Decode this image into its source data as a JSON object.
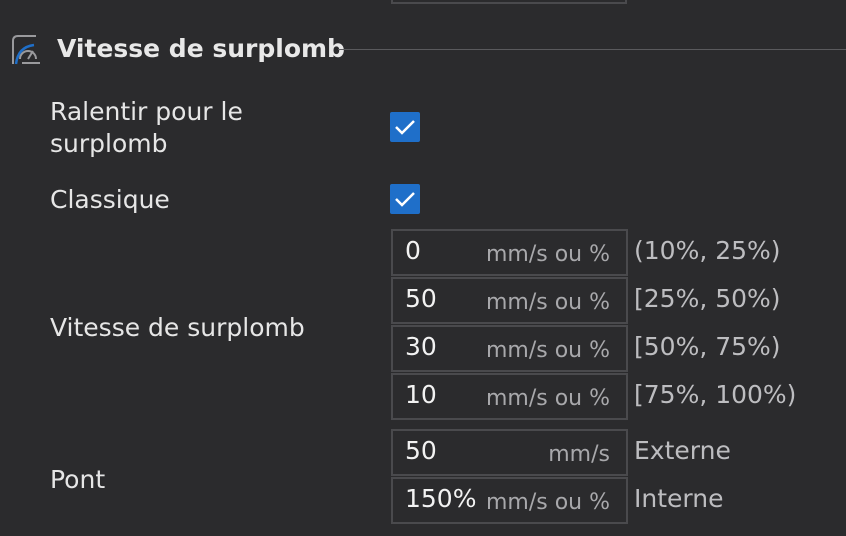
{
  "section": {
    "title": "Vitesse de surplomb",
    "icon": "overhang-speed-icon"
  },
  "slow_down": {
    "label_line1": "Ralentir pour le",
    "label_line2": "surplomb",
    "checked": true
  },
  "classic": {
    "label": "Classique",
    "checked": true
  },
  "overhang_speed": {
    "label": "Vitesse de surplomb",
    "rows": [
      {
        "value": "0",
        "unit": "mm/s ou %",
        "range": "(10%, 25%)"
      },
      {
        "value": "50",
        "unit": "mm/s ou %",
        "range": "[25%, 50%)"
      },
      {
        "value": "30",
        "unit": "mm/s ou %",
        "range": "[50%, 75%)"
      },
      {
        "value": "10",
        "unit": "mm/s ou %",
        "range": "[75%, 100%)"
      }
    ]
  },
  "bridge": {
    "label": "Pont",
    "rows": [
      {
        "value": "50",
        "unit": "mm/s",
        "type": "Externe"
      },
      {
        "value": "150%",
        "unit": "mm/s ou %",
        "type": "Interne"
      }
    ]
  },
  "colors": {
    "background": "#2b2b2d",
    "checkbox": "#1f6fc9",
    "field_border": "#4a4a4d"
  }
}
